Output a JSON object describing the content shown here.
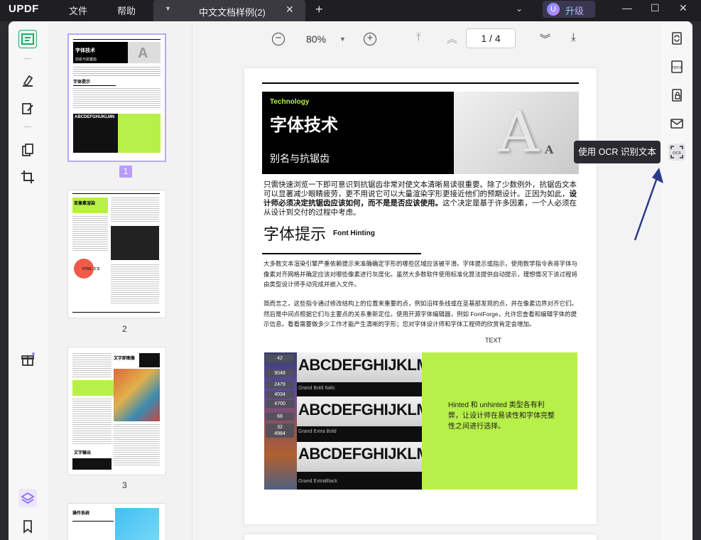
{
  "app": {
    "logo": "UPDF",
    "menu": [
      "文件",
      "帮助"
    ]
  },
  "tab": {
    "title": "中文文档样例(2)",
    "close": "✕",
    "add": "+"
  },
  "upgrade": {
    "avatar": "U",
    "label": "升级"
  },
  "window": {
    "minimize": "—",
    "maximize": "☐",
    "close": "✕"
  },
  "toolbar": {
    "zoom": "80%",
    "page_current": "1",
    "page_sep": "/",
    "page_total": "4"
  },
  "thumbnails": [
    {
      "label": "1",
      "selected": true
    },
    {
      "label": "2",
      "selected": false
    },
    {
      "label": "3",
      "selected": false
    }
  ],
  "thumb_text": {
    "t1_title": "字体技术",
    "t1_sub": "别名与抗锯齿",
    "t1_h": "字体提示",
    "t1_h_en": "Font Hinting",
    "t1_abc": "ABCDEFGHIJKLMN",
    "t2_title": "亚像素渲染",
    "t2_html": "HTML 文本",
    "t3_title": "文字即图像",
    "t3_out": "文字输出",
    "t4_title": "操作系统"
  },
  "document": {
    "banner_tag": "Technology",
    "title": "字体技术",
    "subtitle": "别名与抗锯齿",
    "para1_a": "只需快速浏览一下即可意识到抗锯齿非常对使文本清晰易读很重要。除了少数例外，抗锯齿文本可以显著减少眼睛疲劳，更不用说它可以大量渲染字形更接近他们的预期设计。正因为如此，",
    "para1_bold": "设计师必须决定抗锯齿应该如何，而不是是否应该使用。",
    "para1_c": "这个决定是基于许多因素，一个人必须在从设计到交付的过程中考虑。",
    "heading": "字体提示",
    "heading_en": "Font Hinting",
    "para2": "大多数文本渲染引擎严重依赖提示来准确确定字形的哪些区域应该被平滑。字体提示或指示，使用数学指令表将字体与像素对齐网格并确定应该对哪些像素进行灰度化。虽然大多数软件使用标准化算法提供自动提示，理想情况下该过程将由类型设计师手动完成并嵌入文件。",
    "para3": "简而言之，这些指令通过修改结构上的位置来重要的点，例如沿样条线或在茎基部发现的点，并在像素边界对齐它们。然后是中间点根据它们与主要点的关系重新定位。使用开源字体编辑器，例如 FontForge，允许您查看和编辑字体的提示信息。看看需要做多少工作才能产生清晰的字形；您对字体设计师和字体工程师的欣赏肯定会增加。",
    "caption": "TEXT",
    "figure_rows": [
      {
        "num": "42",
        "text": "ABCDEFGHIJKLMNO",
        "label": ""
      },
      {
        "num": "9048",
        "text": "",
        "label": ""
      },
      {
        "num": "2479",
        "text": "",
        "label": ""
      },
      {
        "num": "4034",
        "text": "",
        "label": "Grand Bold Italic"
      },
      {
        "num": "4700",
        "text": "ABCDEFGHIJKLMNO",
        "label": ""
      },
      {
        "num": "68",
        "text": "",
        "label": ""
      },
      {
        "num": "32",
        "text": "",
        "label": "Grand Extra Bold"
      },
      {
        "num": "4984",
        "text": "ABCDEFGHIJKLMNO",
        "label": ""
      },
      {
        "num": "",
        "text": "",
        "label": "Grand ExtraBlack"
      }
    ],
    "figure_green_text": "Hinted 和 unhinted 类型各有利弊，让设计师在易读性和字体完整性之间进行选择。"
  },
  "tooltip": "使用 OCR 识别文本",
  "colors": {
    "accent": "#b8f04a",
    "brand_purple": "#9f86f2",
    "tooltip_bg": "#2b2b2f",
    "arrow": "#2c3a8c"
  }
}
